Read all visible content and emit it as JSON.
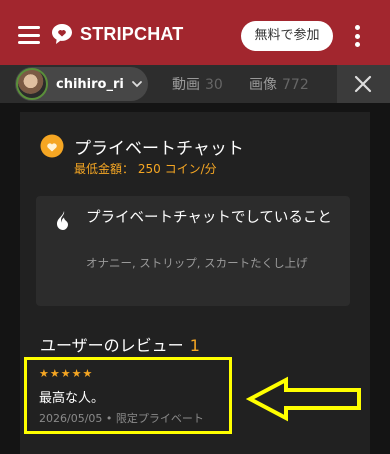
{
  "header": {
    "brand": "STRIPCHAT",
    "join_label": "無料で参加"
  },
  "tabs": {
    "username": "chihiro_ri",
    "video_label": "動画",
    "video_count": "30",
    "photo_label": "画像",
    "photo_count": "772"
  },
  "private_chat": {
    "title": "プライベートチャット",
    "price_label": "最低金額：",
    "price_value": "250 コイン/分"
  },
  "activity": {
    "title": "プライベートチャットでしていること",
    "description": "オナニー, ストリップ, スカートたくし上げ"
  },
  "reviews": {
    "heading": "ユーザーのレビュー",
    "count": "1",
    "items": [
      {
        "stars": "★★★★★",
        "text": "最高な人。",
        "date": "2026/05/05",
        "separator": "•",
        "type": "限定プライベート"
      }
    ]
  },
  "colors": {
    "brand_red": "#a2262e",
    "accent_orange": "#f5a623",
    "highlight_yellow": "#ffff00"
  }
}
